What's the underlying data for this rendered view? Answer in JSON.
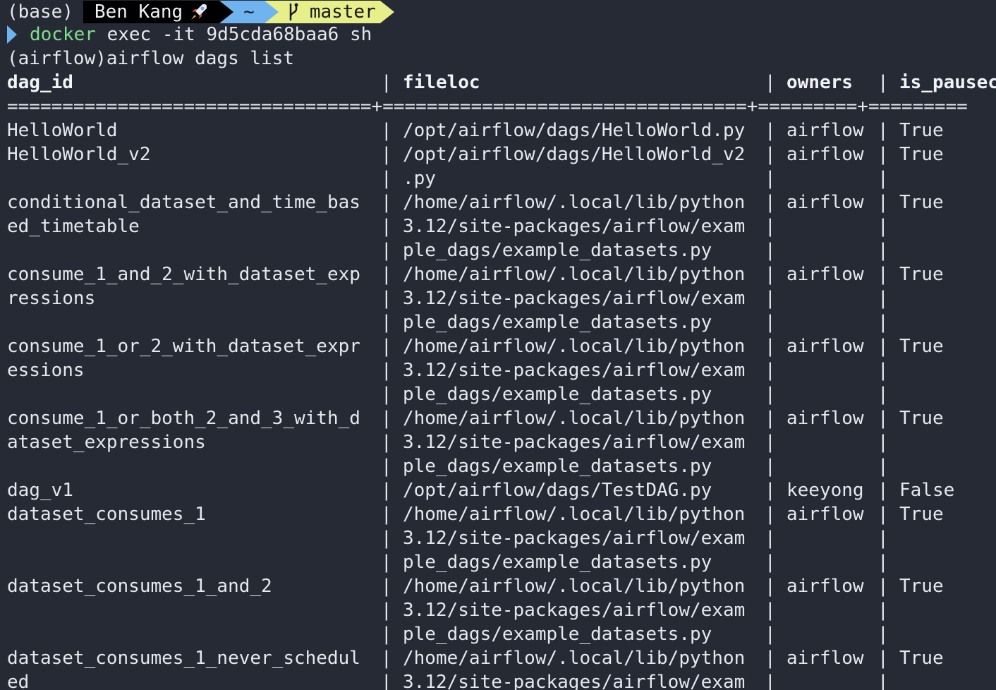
{
  "prompt": {
    "env": "(base)",
    "user": "Ben Kang",
    "dir": "~",
    "branch": "master"
  },
  "command": {
    "name": "docker",
    "args": " exec -it 9d5cda68baa6 sh"
  },
  "subshell_line": "(airflow)airflow dags list",
  "table": {
    "headers": [
      "dag_id",
      "fileloc",
      "owners",
      "is_pausec"
    ],
    "separator": "=================================+=================================+=========+=========",
    "rows": [
      {
        "dag_id": [
          "HelloWorld"
        ],
        "fileloc": [
          "/opt/airflow/dags/HelloWorld.py"
        ],
        "owners": "airflow",
        "is_paused": "True"
      },
      {
        "dag_id": [
          "HelloWorld_v2"
        ],
        "fileloc": [
          "/opt/airflow/dags/HelloWorld_v2",
          ".py"
        ],
        "owners": "airflow",
        "is_paused": "True"
      },
      {
        "dag_id": [
          "conditional_dataset_and_time_bas",
          "ed_timetable"
        ],
        "fileloc": [
          "/home/airflow/.local/lib/python",
          "3.12/site-packages/airflow/exam",
          "ple_dags/example_datasets.py"
        ],
        "owners": "airflow",
        "is_paused": "True"
      },
      {
        "dag_id": [
          "consume_1_and_2_with_dataset_exp",
          "ressions"
        ],
        "fileloc": [
          "/home/airflow/.local/lib/python",
          "3.12/site-packages/airflow/exam",
          "ple_dags/example_datasets.py"
        ],
        "owners": "airflow",
        "is_paused": "True"
      },
      {
        "dag_id": [
          "consume_1_or_2_with_dataset_expr",
          "essions"
        ],
        "fileloc": [
          "/home/airflow/.local/lib/python",
          "3.12/site-packages/airflow/exam",
          "ple_dags/example_datasets.py"
        ],
        "owners": "airflow",
        "is_paused": "True"
      },
      {
        "dag_id": [
          "consume_1_or_both_2_and_3_with_d",
          "ataset_expressions"
        ],
        "fileloc": [
          "/home/airflow/.local/lib/python",
          "3.12/site-packages/airflow/exam",
          "ple_dags/example_datasets.py"
        ],
        "owners": "airflow",
        "is_paused": "True"
      },
      {
        "dag_id": [
          "dag_v1"
        ],
        "fileloc": [
          "/opt/airflow/dags/TestDAG.py"
        ],
        "owners": "keeyong",
        "is_paused": "False"
      },
      {
        "dag_id": [
          "dataset_consumes_1"
        ],
        "fileloc": [
          "/home/airflow/.local/lib/python",
          "3.12/site-packages/airflow/exam",
          "ple_dags/example_datasets.py"
        ],
        "owners": "airflow",
        "is_paused": "True"
      },
      {
        "dag_id": [
          "dataset_consumes_1_and_2"
        ],
        "fileloc": [
          "/home/airflow/.local/lib/python",
          "3.12/site-packages/airflow/exam",
          "ple_dags/example_datasets.py"
        ],
        "owners": "airflow",
        "is_paused": "True"
      },
      {
        "dag_id": [
          "dataset_consumes_1_never_schedul",
          "ed"
        ],
        "fileloc": [
          "/home/airflow/.local/lib/python",
          "3.12/site-packages/airflow/exam"
        ],
        "owners": "airflow",
        "is_paused": "True"
      }
    ]
  },
  "colors": {
    "background": "#262a35",
    "text": "#e6e8ee",
    "command": "#7ee08c",
    "segment_user": "#000000",
    "segment_dir": "#6fb4ee",
    "segment_git": "#e6ef8a"
  },
  "icons": {
    "user_segment": "rocket-icon",
    "git_segment": "git-branch-icon",
    "prompt": "prompt-chevron-icon"
  }
}
